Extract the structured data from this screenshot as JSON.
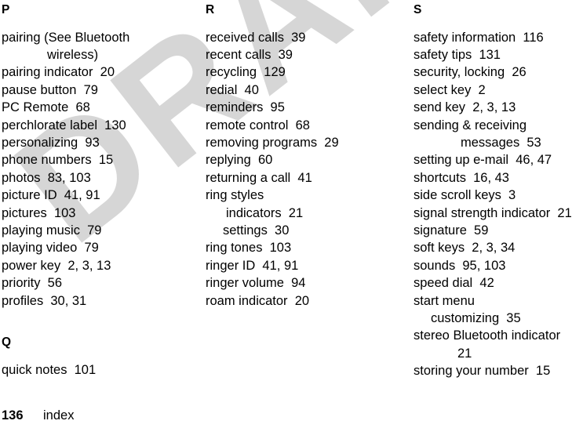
{
  "page": {
    "number": "136",
    "label": "index",
    "watermark": "DRAFT",
    "watermark_color": "#d6d6d6"
  },
  "columns": [
    {
      "id": "col-1",
      "sections": [
        {
          "letter": "P",
          "entries": [
            {
              "text": "pairing (See Bluetooth",
              "indent": "none"
            },
            {
              "text": "wireless)",
              "indent": "cont-58"
            },
            {
              "text": "pairing indicator  20",
              "indent": "none"
            },
            {
              "text": "pause button  79",
              "indent": "none"
            },
            {
              "text": "PC Remote  68",
              "indent": "none"
            },
            {
              "text": "perchlorate label  130",
              "indent": "none"
            },
            {
              "text": "personalizing  93",
              "indent": "none"
            },
            {
              "text": "phone numbers  15",
              "indent": "none"
            },
            {
              "text": "photos  83, 103",
              "indent": "none"
            },
            {
              "text": "picture ID  41, 91",
              "indent": "none"
            },
            {
              "text": "pictures  103",
              "indent": "none"
            },
            {
              "text": "playing music  79",
              "indent": "none"
            },
            {
              "text": "playing video  79",
              "indent": "none"
            },
            {
              "text": "power key  2, 3, 13",
              "indent": "none"
            },
            {
              "text": "priority  56",
              "indent": "none"
            },
            {
              "text": "profiles  30, 31",
              "indent": "none"
            }
          ]
        },
        {
          "letter": "Q",
          "entries": [
            {
              "text": "quick notes  101",
              "indent": "none"
            }
          ]
        }
      ]
    },
    {
      "id": "col-2",
      "sections": [
        {
          "letter": "R",
          "entries": [
            {
              "text": "received calls  39",
              "indent": "none"
            },
            {
              "text": "recent calls  39",
              "indent": "none"
            },
            {
              "text": "recycling  129",
              "indent": "none"
            },
            {
              "text": "redial  40",
              "indent": "none"
            },
            {
              "text": "reminders  95",
              "indent": "none"
            },
            {
              "text": "remote control  68",
              "indent": "none"
            },
            {
              "text": "removing programs  29",
              "indent": "none"
            },
            {
              "text": "replying  60",
              "indent": "none"
            },
            {
              "text": "returning a call  41",
              "indent": "none"
            },
            {
              "text": "ring styles",
              "indent": "none"
            },
            {
              "text": "indicators  21",
              "indent": "sub"
            },
            {
              "text": "settings  30",
              "indent": "sub2"
            },
            {
              "text": "ring tones  103",
              "indent": "none"
            },
            {
              "text": "ringer ID  41, 91",
              "indent": "none"
            },
            {
              "text": "ringer volume  94",
              "indent": "none"
            },
            {
              "text": "roam indicator  20",
              "indent": "none"
            }
          ]
        }
      ]
    },
    {
      "id": "col-3",
      "sections": [
        {
          "letter": "S",
          "entries": [
            {
              "text": "safety information  116",
              "indent": "none"
            },
            {
              "text": "safety tips  131",
              "indent": "none"
            },
            {
              "text": "security, locking  26",
              "indent": "none"
            },
            {
              "text": "select key  2",
              "indent": "none"
            },
            {
              "text": "send key  2, 3, 13",
              "indent": "none"
            },
            {
              "text": "sending & receiving",
              "indent": "none"
            },
            {
              "text": "messages  53",
              "indent": "cont-60"
            },
            {
              "text": "setting up e-mail  46, 47",
              "indent": "none"
            },
            {
              "text": "shortcuts  16, 43",
              "indent": "none"
            },
            {
              "text": "side scroll keys  3",
              "indent": "none"
            },
            {
              "text": "signal strength indicator  21",
              "indent": "none"
            },
            {
              "text": "signature  59",
              "indent": "none"
            },
            {
              "text": "soft keys  2, 3, 34",
              "indent": "none"
            },
            {
              "text": "sounds  95, 103",
              "indent": "none"
            },
            {
              "text": "speed dial  42",
              "indent": "none"
            },
            {
              "text": "start menu",
              "indent": "none"
            },
            {
              "text": "customizing  35",
              "indent": "sub2"
            },
            {
              "text": "stereo Bluetooth indicator",
              "indent": "none"
            },
            {
              "text": "21",
              "indent": "cont-56"
            },
            {
              "text": "storing your number  15",
              "indent": "none"
            }
          ]
        }
      ]
    }
  ]
}
